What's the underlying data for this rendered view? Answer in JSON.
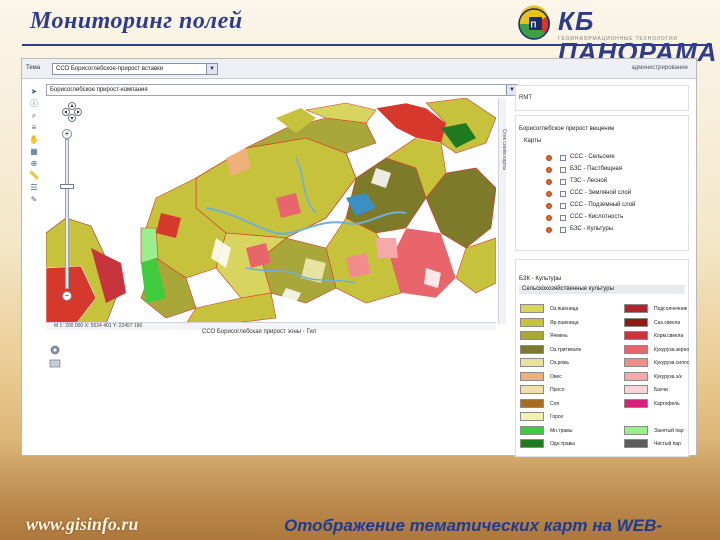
{
  "slide": {
    "title": "Мониторинг полей",
    "brand_name": "КБ ПАНОРАМА",
    "brand_tagline": "ГЕОИНФОРМАЦИОННЫЕ ТЕХНОЛОГИИ",
    "footer_url": "www.gisinfo.ru",
    "footer_caption": "Отображение тематических карт на WEB-сервисе",
    "title_color": "#2f3c8c"
  },
  "app": {
    "topic_label": "Тема",
    "topic_value": "ССО Борисоглебское-прирост вставки",
    "admin_link": "администрирование",
    "map_select_value": "Борисоглебское прирост-компания",
    "vertical_label": "Стек слоёв карты",
    "status_text": "М 1: 200 000    X: 5524 401    Y: 22457 180",
    "map_caption": "ССО Борисоглебская прирост зоны - Гил",
    "panel1_text": "RMT",
    "tree_header": "Борисоглебское прирост вещение",
    "tree_sub": "Карты",
    "layers": [
      {
        "name": "ССС - Сельские"
      },
      {
        "name": "БЗС - Пастбищная"
      },
      {
        "name": "ТЗС - Лесной"
      },
      {
        "name": "ССС - Земляной слой"
      },
      {
        "name": "ССС - Подземный слой"
      },
      {
        "name": "ССС - Кислотность"
      },
      {
        "name": "БЗС - Культуры"
      }
    ],
    "legend_title": "БЗК - Культуры",
    "legend_header": "Сельскохозяйственные культуры",
    "legend_left": [
      {
        "label": "Оз.пшеница",
        "color": "#d8d460"
      },
      {
        "label": "Яр.пшеница",
        "color": "#c7c23b"
      },
      {
        "label": "Ячмень",
        "color": "#a9a63a"
      },
      {
        "label": "Оз.тритикале",
        "color": "#7d7b2a"
      },
      {
        "label": "Оз.рожь",
        "color": "#e9e3a2"
      },
      {
        "label": "Овес",
        "color": "#f0b07a"
      },
      {
        "label": "Просо",
        "color": "#f2e1a6"
      },
      {
        "label": "Соя",
        "color": "#a96b1c"
      },
      {
        "label": "Горох",
        "color": "#f3f0b5"
      },
      {
        "label": "Мн.травы",
        "color": "#3ecb3e"
      },
      {
        "label": "Одн.травы",
        "color": "#1f7a1f"
      }
    ],
    "legend_right": [
      {
        "label": "Подсолнечник",
        "color": "#b0262a"
      },
      {
        "label": "Сах.свекла",
        "color": "#8e1a1a"
      },
      {
        "label": "Корм.свекла",
        "color": "#c8343b"
      },
      {
        "label": "Кукуруза.зерно",
        "color": "#e8656b"
      },
      {
        "label": "Кукуруза.силос",
        "color": "#f28b8c"
      },
      {
        "label": "Кукуруза.з/к",
        "color": "#f7a8ab"
      },
      {
        "label": "Бахчи",
        "color": "#f8d6d8"
      },
      {
        "label": "Картофель",
        "color": "#d91f7a"
      },
      {
        "label": "",
        "color": "#ffffff"
      },
      {
        "label": "Занятый пар",
        "color": "#9bee8c"
      },
      {
        "label": "Чистый пар",
        "color": "#5c5c5c"
      }
    ]
  }
}
